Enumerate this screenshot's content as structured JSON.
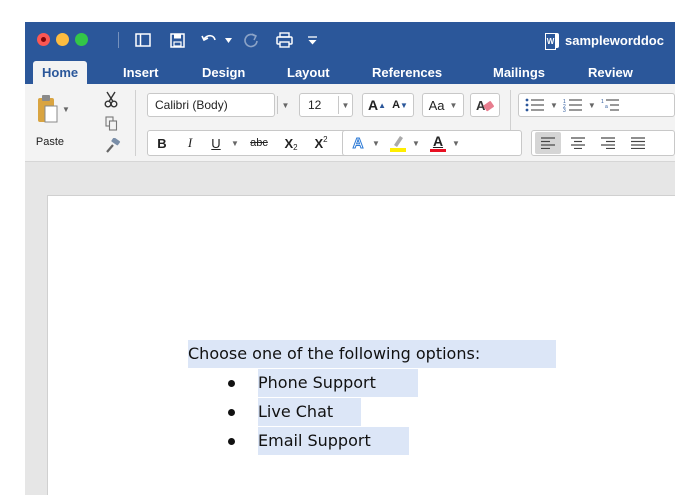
{
  "window": {
    "title": "sampleworddoc"
  },
  "tabs": [
    {
      "label": "Home",
      "active": true
    },
    {
      "label": "Insert"
    },
    {
      "label": "Design"
    },
    {
      "label": "Layout"
    },
    {
      "label": "References"
    },
    {
      "label": "Mailings"
    },
    {
      "label": "Review"
    }
  ],
  "ribbon": {
    "paste_label": "Paste",
    "font_name": "Calibri (Body)",
    "font_size": "12",
    "bold": "B",
    "italic": "I",
    "underline": "U",
    "strikethrough": "abc",
    "subscript": "X",
    "subscript_mark": "2",
    "superscript": "X",
    "superscript_mark": "2",
    "grow_font": "A",
    "shrink_font": "A",
    "change_case": "Aa",
    "font_color_letter": "A",
    "text_effects_letter": "A"
  },
  "colors": {
    "brand": "#2b579a",
    "selection": "#dce6f7",
    "highlight": "#ffee00",
    "font_color": "#e81123"
  },
  "document": {
    "intro": "Choose one of the following options:",
    "bullets": [
      "Phone Support",
      "Live Chat",
      "Email Support"
    ]
  }
}
